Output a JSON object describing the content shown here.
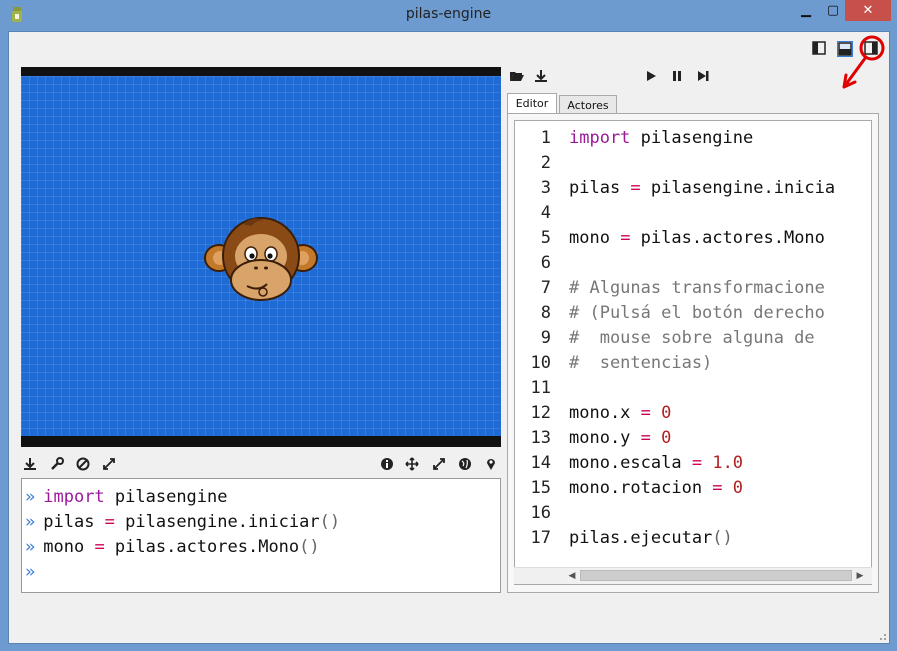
{
  "window": {
    "title": "pilas-engine",
    "min_icon": "minimize-icon",
    "max_icon": "maximize-icon",
    "close_icon": "close-icon",
    "min_glyph": "▁",
    "max_glyph": "▢",
    "close_glyph": "✕"
  },
  "layout_buttons": [
    "layout-left-icon",
    "layout-bottom-icon",
    "layout-right-icon"
  ],
  "stage_toolbar_left": [
    "download-icon",
    "wrench-icon",
    "ban-icon",
    "expand-icon"
  ],
  "stage_toolbar_right": [
    "info-icon",
    "move-icon",
    "resize-icon",
    "globe-icon",
    "pin-icon"
  ],
  "editor_toolbar": {
    "left": [
      "open-folder-icon",
      "download-icon"
    ],
    "center": [
      "play-icon",
      "pause-icon",
      "step-icon"
    ]
  },
  "tabs": [
    {
      "label": "Editor",
      "active": true
    },
    {
      "label": "Actores",
      "active": false
    }
  ],
  "console": {
    "prompt": "»",
    "lines": [
      [
        {
          "t": "import",
          "c": "kw"
        },
        {
          "t": " pilasengine",
          "c": ""
        }
      ],
      [
        {
          "t": "pilas ",
          "c": ""
        },
        {
          "t": "=",
          "c": "op"
        },
        {
          "t": " pilasengine.iniciar",
          "c": ""
        },
        {
          "t": "()",
          "c": "paren"
        }
      ],
      [
        {
          "t": "mono ",
          "c": ""
        },
        {
          "t": "=",
          "c": "op"
        },
        {
          "t": " pilas.actores.Mono",
          "c": ""
        },
        {
          "t": "()",
          "c": "paren"
        }
      ],
      []
    ]
  },
  "editor": {
    "lines": [
      {
        "n": "1",
        "tokens": [
          {
            "t": "import",
            "c": "kw"
          },
          {
            "t": " pilasengine",
            "c": ""
          }
        ]
      },
      {
        "n": "2",
        "tokens": []
      },
      {
        "n": "3",
        "tokens": [
          {
            "t": "pilas ",
            "c": ""
          },
          {
            "t": "=",
            "c": "op"
          },
          {
            "t": " pilasengine.inicia",
            "c": ""
          }
        ]
      },
      {
        "n": "4",
        "tokens": []
      },
      {
        "n": "5",
        "tokens": [
          {
            "t": "mono ",
            "c": ""
          },
          {
            "t": "=",
            "c": "op"
          },
          {
            "t": " pilas.actores.Mono",
            "c": ""
          }
        ]
      },
      {
        "n": "6",
        "tokens": []
      },
      {
        "n": "7",
        "tokens": [
          {
            "t": "# Algunas transformacione",
            "c": "cm"
          }
        ]
      },
      {
        "n": "8",
        "tokens": [
          {
            "t": "# (Pulsá el botón derecho",
            "c": "cm"
          }
        ]
      },
      {
        "n": "9",
        "tokens": [
          {
            "t": "#  mouse sobre alguna de",
            "c": "cm"
          }
        ]
      },
      {
        "n": "10",
        "tokens": [
          {
            "t": "#  sentencias)",
            "c": "cm"
          }
        ]
      },
      {
        "n": "11",
        "tokens": []
      },
      {
        "n": "12",
        "tokens": [
          {
            "t": "mono.x ",
            "c": ""
          },
          {
            "t": "=",
            "c": "op"
          },
          {
            "t": " ",
            "c": ""
          },
          {
            "t": "0",
            "c": "num"
          }
        ]
      },
      {
        "n": "13",
        "tokens": [
          {
            "t": "mono.y ",
            "c": ""
          },
          {
            "t": "=",
            "c": "op"
          },
          {
            "t": " ",
            "c": ""
          },
          {
            "t": "0",
            "c": "num"
          }
        ]
      },
      {
        "n": "14",
        "tokens": [
          {
            "t": "mono.escala ",
            "c": ""
          },
          {
            "t": "=",
            "c": "op"
          },
          {
            "t": " ",
            "c": ""
          },
          {
            "t": "1.0",
            "c": "num"
          }
        ]
      },
      {
        "n": "15",
        "tokens": [
          {
            "t": "mono.rotacion ",
            "c": ""
          },
          {
            "t": "=",
            "c": "op"
          },
          {
            "t": " ",
            "c": ""
          },
          {
            "t": "0",
            "c": "num"
          }
        ]
      },
      {
        "n": "16",
        "tokens": []
      },
      {
        "n": "17",
        "tokens": [
          {
            "t": "pilas.ejecutar",
            "c": ""
          },
          {
            "t": "()",
            "c": "paren"
          }
        ]
      }
    ]
  },
  "scrollbar": {
    "left_arrow": "◀",
    "right_arrow": "▶"
  },
  "colors": {
    "stage_bg": "#1f6bd6",
    "keyword": "#9b1a9b",
    "operator": "#cc0055",
    "number": "#b22222",
    "comment": "#777777",
    "annotation": "#e00000"
  }
}
